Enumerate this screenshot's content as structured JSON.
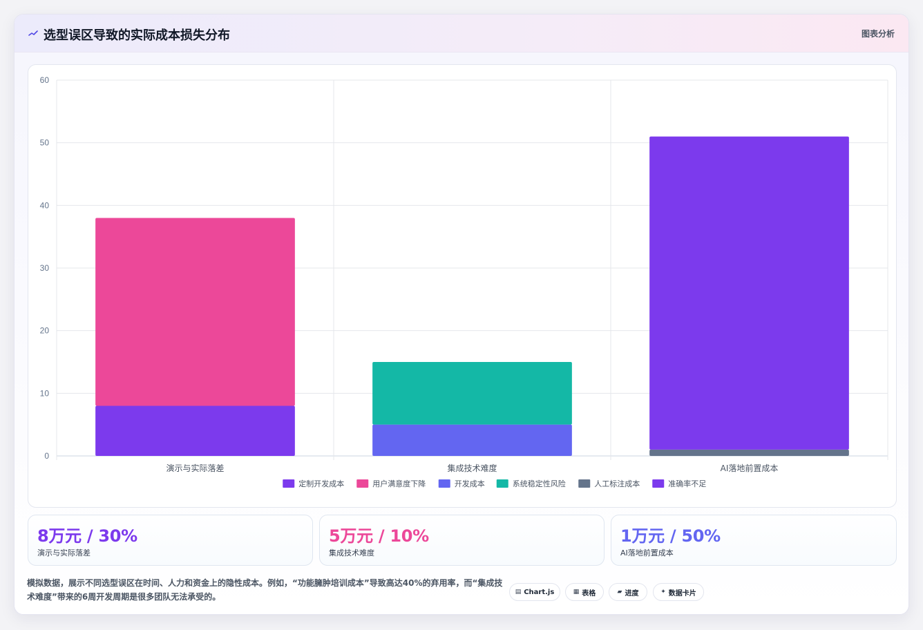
{
  "header": {
    "icon": "sparkline-icon",
    "title": "选型误区导致的实际成本损失分布",
    "right_label": "图表分析"
  },
  "chart_data": {
    "type": "bar",
    "stacked": true,
    "categories": [
      "演示与实际落差",
      "集成技术难度",
      "AI落地前置成本"
    ],
    "ylim": [
      0,
      60
    ],
    "yticks": [
      0,
      10,
      20,
      30,
      40,
      50,
      60
    ],
    "grid": true,
    "legend_position": "bottom",
    "series": [
      {
        "name": "定制开发成本",
        "color": "#7c3aed",
        "values": [
          8,
          0,
          0
        ]
      },
      {
        "name": "用户满意度下降",
        "color": "#ec4899",
        "values": [
          30,
          0,
          0
        ]
      },
      {
        "name": "开发成本",
        "color": "#6366f1",
        "values": [
          0,
          5,
          0
        ]
      },
      {
        "name": "系统稳定性风险",
        "color": "#14b8a6",
        "values": [
          0,
          10,
          0
        ]
      },
      {
        "name": "人工标注成本",
        "color": "#64748b",
        "values": [
          0,
          0,
          1
        ]
      },
      {
        "name": "准确率不足",
        "color": "#7c3aed",
        "values": [
          0,
          0,
          50
        ]
      }
    ]
  },
  "stats": [
    {
      "value": "8万元 / 30%",
      "label": "演示与实际落差",
      "color": "#7c3aed"
    },
    {
      "value": "5万元 / 10%",
      "label": "集成技术难度",
      "color": "#ec4899"
    },
    {
      "value": "1万元 / 50%",
      "label": "AI落地前置成本",
      "color": "#6366f1"
    }
  ],
  "footnote": "模拟数据，展示不同选型误区在时间、人力和资金上的隐性成本。例如，“功能臃肿培训成本”导致高达40%的弃用率，而“集成技术难度”带来的6周开发周期是很多团队无法承受的。",
  "pills": [
    {
      "icon": "▤",
      "label": "Chart.js"
    },
    {
      "icon": "▦",
      "label": "表格"
    },
    {
      "icon": "▰",
      "label": "进度"
    },
    {
      "icon": "✦",
      "label": "数据卡片"
    }
  ]
}
